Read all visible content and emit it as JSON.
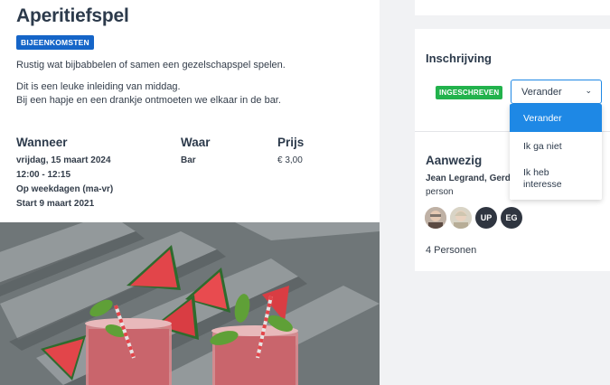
{
  "event": {
    "title": "Aperitiefspel",
    "category_badge": "BIJEENKOMSTEN",
    "description_1": "Rustig wat bijbabbelen of samen een gezelschapspel spelen.",
    "description_2": "Dit is een leuke inleiding van middag.",
    "description_3": "Bij een hapje en een drankje ontmoeten we elkaar in de bar.",
    "when": {
      "label": "Wanneer",
      "date": "vrijdag, 15 maart 2024",
      "time": "12:00 - 12:15",
      "recurrence": "Op weekdagen (ma-vr)",
      "start": "Start 9 maart 2021"
    },
    "where": {
      "label": "Waar",
      "value": "Bar"
    },
    "price": {
      "label": "Prijs",
      "value": "€ 3,00"
    }
  },
  "registration": {
    "heading": "Inschrijving",
    "status": "INGESCHREVEN",
    "select_value": "Verander",
    "dropdown_options": [
      "Verander",
      "Ik ga niet",
      "Ik heb interesse"
    ],
    "status_color": "#22b24c",
    "accent_color": "#1e88e5"
  },
  "attendance": {
    "heading": "Aanwezig",
    "names_line_1": "Jean Legrand, Gerda",
    "names_line_2": "person",
    "avatars": [
      {
        "initials": "",
        "type": "photo"
      },
      {
        "initials": "",
        "type": "photo"
      },
      {
        "initials": "UP",
        "type": "initials"
      },
      {
        "initials": "EG",
        "type": "initials"
      }
    ],
    "count": "4 Personen"
  }
}
